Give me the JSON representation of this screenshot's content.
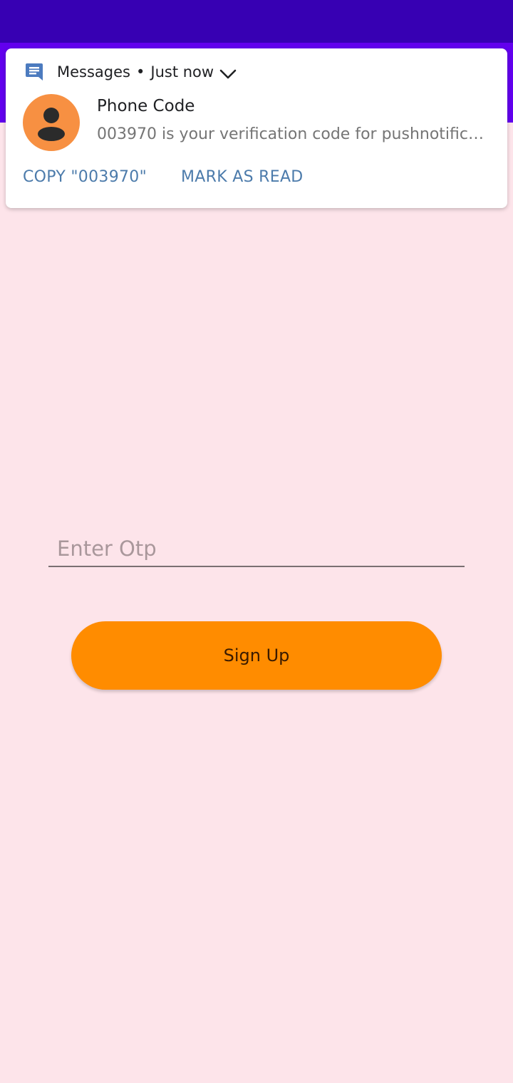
{
  "notification": {
    "app_name": "Messages",
    "separator": "•",
    "time": "Just now",
    "app_icon": "messages-icon",
    "expand_icon": "chevron-down-icon",
    "avatar_icon": "person-icon",
    "sender": "Phone Code",
    "message": "003970 is your verification code for pushnotificatio...",
    "actions": [
      {
        "label": "COPY \"003970\""
      },
      {
        "label": "MARK AS READ"
      }
    ]
  },
  "form": {
    "otp_placeholder": "Enter Otp",
    "otp_value": "",
    "signup_label": "Sign Up"
  },
  "colors": {
    "status_bar": "#3700b3",
    "app_bar": "#6200ee",
    "background": "#fde4ea",
    "avatar": "#f79042",
    "action_text": "#4c7bab",
    "button": "#ff8c00"
  }
}
